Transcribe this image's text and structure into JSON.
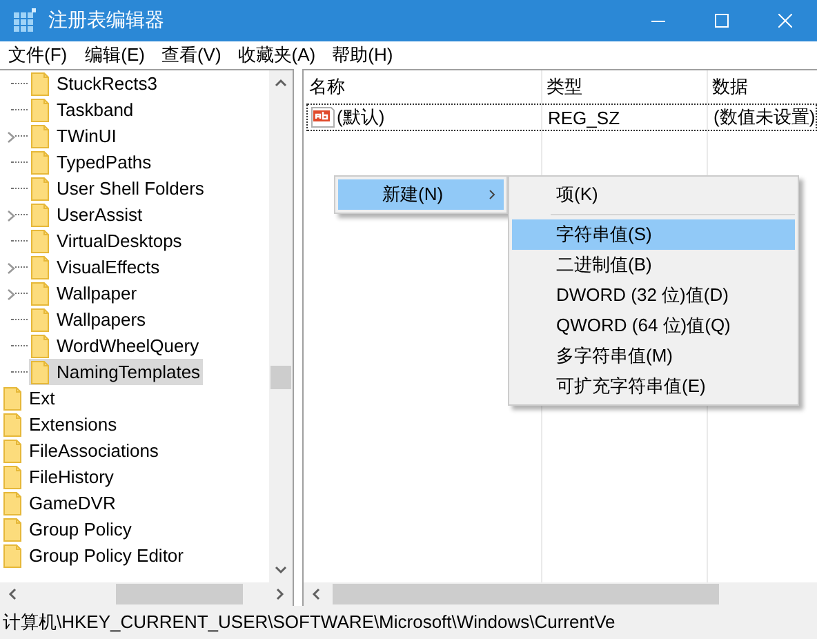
{
  "window": {
    "title": "注册表编辑器"
  },
  "menu": [
    {
      "label": "文件(F)"
    },
    {
      "label": "编辑(E)"
    },
    {
      "label": "查看(V)"
    },
    {
      "label": "收藏夹(A)"
    },
    {
      "label": "帮助(H)"
    }
  ],
  "tree": {
    "items": [
      {
        "children": [
          {
            "label": "StuckRects3",
            "expandable": false,
            "selected": false
          },
          {
            "label": "Taskband",
            "expandable": false,
            "selected": false
          },
          {
            "label": "TWinUI",
            "expandable": true,
            "selected": false
          },
          {
            "label": "TypedPaths",
            "expandable": false,
            "selected": false
          },
          {
            "label": "User Shell Folders",
            "expandable": false,
            "selected": false
          },
          {
            "label": "UserAssist",
            "expandable": true,
            "selected": false
          },
          {
            "label": "VirtualDesktops",
            "expandable": false,
            "selected": false
          },
          {
            "label": "VisualEffects",
            "expandable": true,
            "selected": false
          },
          {
            "label": "Wallpaper",
            "expandable": true,
            "selected": false
          },
          {
            "label": "Wallpapers",
            "expandable": false,
            "selected": false
          },
          {
            "label": "WordWheelQuery",
            "expandable": false,
            "selected": false
          },
          {
            "label": "NamingTemplates",
            "expandable": false,
            "selected": true
          }
        ]
      },
      {
        "label": "Ext",
        "selected": false
      },
      {
        "label": "Extensions",
        "selected": false
      },
      {
        "label": "FileAssociations",
        "selected": false
      },
      {
        "label": "FileHistory",
        "selected": false
      },
      {
        "label": "GameDVR",
        "selected": false
      },
      {
        "label": "Group Policy",
        "selected": false
      },
      {
        "label": "Group Policy Editor",
        "selected": false
      }
    ]
  },
  "table": {
    "columns": [
      "名称",
      "类型",
      "数据"
    ],
    "rows": [
      {
        "name": "(默认)",
        "type": "REG_SZ",
        "data": "(数值未设置)",
        "focused": true
      }
    ]
  },
  "context_menu": {
    "items": [
      {
        "label": "新建(N)",
        "selected": true,
        "submenu": true
      }
    ]
  },
  "submenu": {
    "items": [
      {
        "kind": "item",
        "label": "项(K)",
        "selected": false
      },
      {
        "kind": "separator"
      },
      {
        "kind": "item",
        "label": "字符串值(S)",
        "selected": true
      },
      {
        "kind": "item",
        "label": "二进制值(B)",
        "selected": false
      },
      {
        "kind": "item",
        "label": "DWORD (32 位)值(D)",
        "selected": false
      },
      {
        "kind": "item",
        "label": "QWORD (64 位)值(Q)",
        "selected": false
      },
      {
        "kind": "item",
        "label": "多字符串值(M)",
        "selected": false
      },
      {
        "kind": "item",
        "label": "可扩充字符串值(E)",
        "selected": false
      }
    ]
  },
  "status_bar": {
    "path": "计算机\\HKEY_CURRENT_USER\\SOFTWARE\\Microsoft\\Windows\\CurrentVe"
  }
}
